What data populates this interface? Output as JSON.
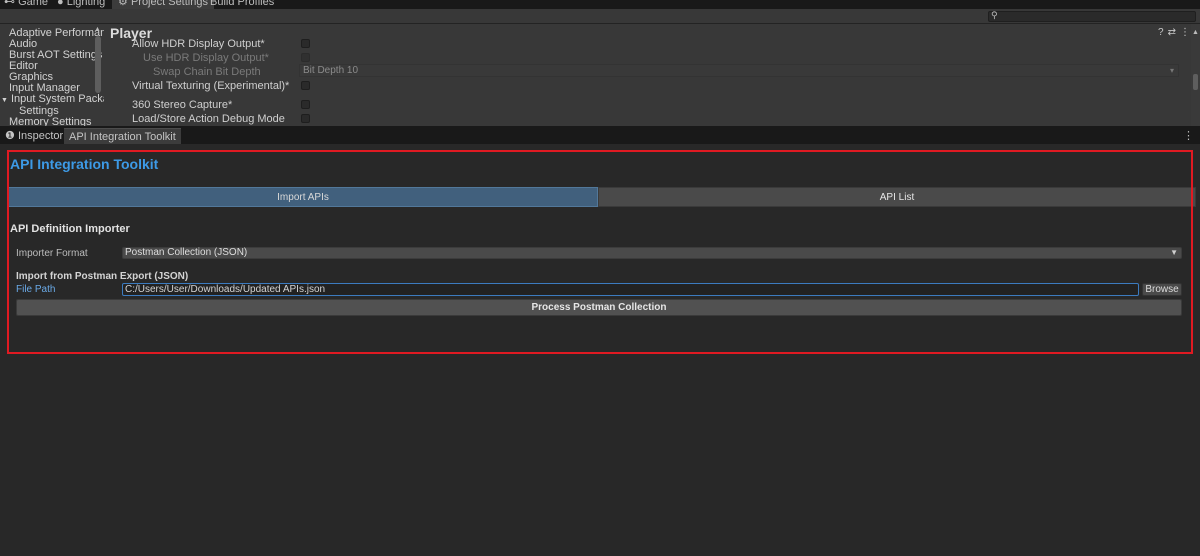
{
  "top_tabs": [
    {
      "label": "Game",
      "icon": "gamepad-icon"
    },
    {
      "label": "Lighting",
      "icon": "bulb-icon"
    },
    {
      "label": "Project Settings",
      "icon": "gear-icon",
      "active": true
    },
    {
      "label": "Build Profiles"
    }
  ],
  "project_settings": {
    "categories": [
      "Adaptive Performanc",
      "Audio",
      "Burst AOT Settings",
      "Editor",
      "Graphics",
      "Input Manager",
      "Input System Packag",
      "Settings",
      "Memory Settings"
    ],
    "panel_title": "Player",
    "rows": [
      {
        "label": "Allow HDR Display Output*",
        "control": "checkbox"
      },
      {
        "label": "Use HDR Display Output*",
        "control": "checkbox",
        "disabled": true
      },
      {
        "label": "Swap Chain Bit Depth",
        "control": "dropdown",
        "value": "Bit Depth 10",
        "disabled": true
      },
      {
        "label": "Virtual Texturing (Experimental)*",
        "control": "checkbox"
      },
      {
        "label": "360 Stereo Capture*",
        "control": "checkbox"
      },
      {
        "label": "Load/Store Action Debug Mode",
        "control": "checkbox"
      }
    ]
  },
  "bottom_tabs": [
    {
      "label": "Inspector",
      "icon": "info-icon"
    },
    {
      "label": "API Integration Toolkit",
      "active": true
    }
  ],
  "toolkit": {
    "title": "API Integration Toolkit",
    "tabs": [
      {
        "label": "Import APIs",
        "active": true
      },
      {
        "label": "API List",
        "active": false
      }
    ],
    "section_heading": "API Definition Importer",
    "importer_format_label": "Importer Format",
    "importer_format_value": "Postman Collection (JSON)",
    "import_heading": "Import from Postman Export (JSON)",
    "file_path_label": "File Path",
    "file_path_value": "C:/Users/User/Downloads/Updated APIs.json",
    "browse_label": "Browse",
    "process_label": "Process Postman Collection"
  },
  "colors": {
    "accent_title": "#3d9ae6",
    "active_tab": "#41607d",
    "highlight_border": "#e01a22",
    "input_focus": "#3c7bbf"
  }
}
